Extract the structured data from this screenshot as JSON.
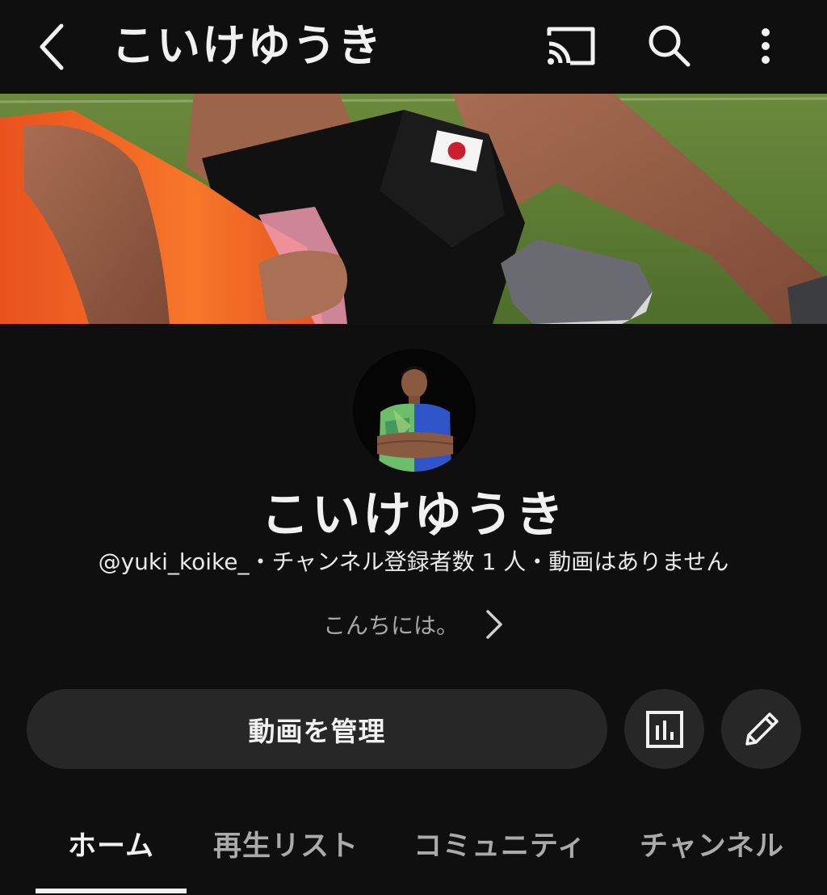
{
  "header": {
    "title": "こいけゆうき",
    "icons": [
      "back-chevron-icon",
      "cast-icon",
      "search-icon",
      "more-vert-icon"
    ]
  },
  "banner": {
    "description_hidden": true
  },
  "channel": {
    "name": "こいけゆうき",
    "meta": "@yuki_koike_・チャンネル登録者数 1 人・動画はありません",
    "description": "こんちには。"
  },
  "actions": {
    "manage_videos": "動画を管理",
    "stats_icon": "analytics-icon",
    "edit_icon": "pencil-icon"
  },
  "tabs": [
    {
      "label": "ホーム",
      "active": true
    },
    {
      "label": "再生リスト",
      "active": false
    },
    {
      "label": "コミュニティ",
      "active": false
    },
    {
      "label": "チャンネル",
      "active": false
    }
  ],
  "colors": {
    "background": "#0f0f0f",
    "button": "#272727",
    "text": "#f1f1f1",
    "muted": "#aaaaaa"
  }
}
